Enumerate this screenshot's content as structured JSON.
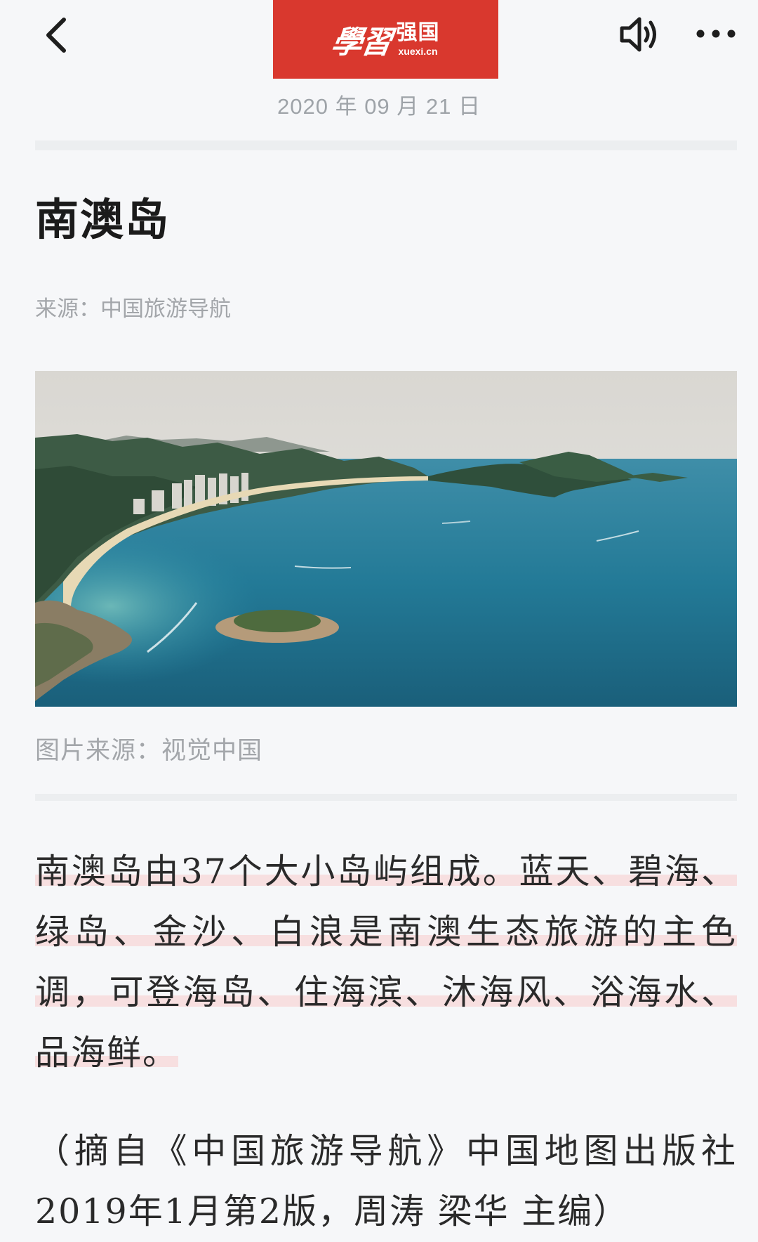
{
  "header": {
    "back_icon": "chevron-left-icon",
    "logo": {
      "script_text": "學習",
      "name": "强国",
      "url": "xuexi.cn",
      "color": "#d9382e"
    },
    "speaker_icon": "speaker-icon",
    "more_icon": "more-dots-icon"
  },
  "article": {
    "date": "2020 年 09 月 21 日",
    "title": "南澳岛",
    "source": "来源：中国旅游导航",
    "image_caption": "图片来源：视觉中国",
    "body": "南澳岛由37个大小岛屿组成。蓝天、碧海、绿岛、金沙、白浪是南澳生态旅游的主色调，可登海岛、住海滨、沐海风、浴海水、品海鲜。",
    "citation": "（摘自《中国旅游导航》中国地图出版社2019年1月第2版，周涛 梁华 主编）",
    "highlight_color": "#f7dfe0"
  }
}
